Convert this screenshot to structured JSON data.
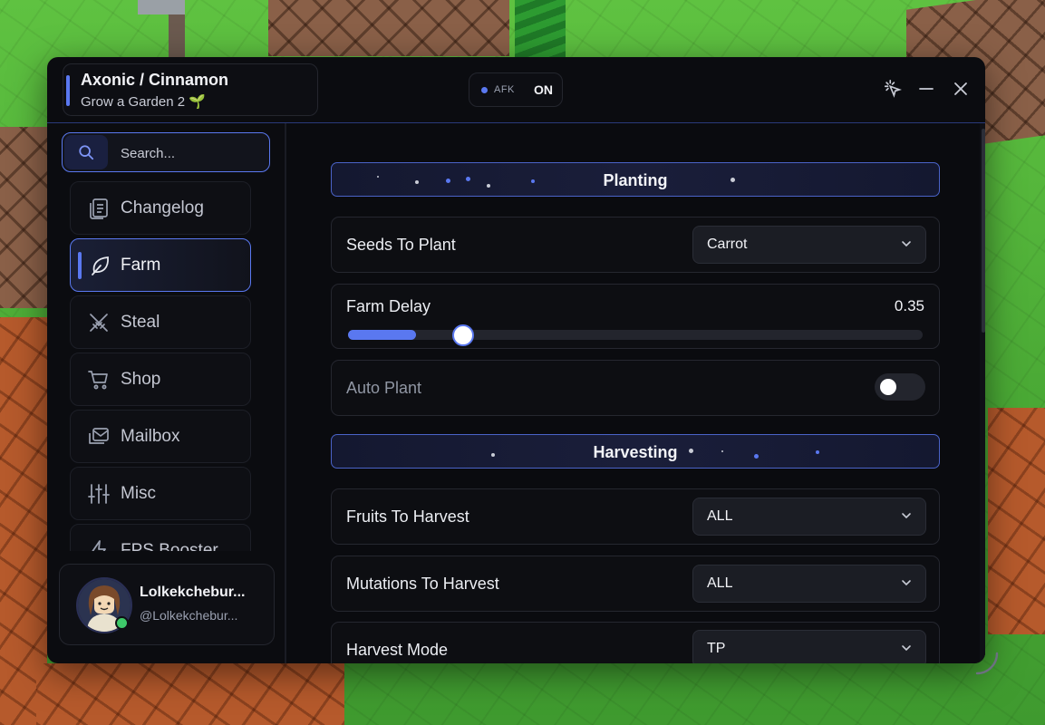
{
  "window": {
    "title": "Axonic / Cinnamon",
    "subtitle": "Grow a Garden 2",
    "subtitle_icon": "🌱",
    "afk": {
      "label": "AFK",
      "state": "ON"
    },
    "controls": [
      "cursor-click-icon",
      "minimize-icon",
      "close-icon"
    ]
  },
  "colors": {
    "accent": "#5a78f0",
    "online": "#3ec96a",
    "window_bg": "#0b0c10"
  },
  "sidebar": {
    "search": {
      "placeholder": "Search..."
    },
    "items": [
      {
        "label": "Changelog",
        "icon": "changelog-icon",
        "active": false
      },
      {
        "label": "Farm",
        "icon": "leaf-icon",
        "active": true
      },
      {
        "label": "Steal",
        "icon": "swords-icon",
        "active": false
      },
      {
        "label": "Shop",
        "icon": "cart-icon",
        "active": false
      },
      {
        "label": "Mailbox",
        "icon": "mailbox-icon",
        "active": false
      },
      {
        "label": "Misc",
        "icon": "sliders-icon",
        "active": false
      },
      {
        "label": "FPS Booster",
        "icon": "lightning-icon",
        "active": false
      }
    ],
    "profile": {
      "name": "Lolkekchebur...",
      "handle": "@Lolkekchebur...",
      "status": "online"
    }
  },
  "main": {
    "sections": [
      {
        "title": "Planting",
        "rows": [
          {
            "type": "dropdown",
            "label": "Seeds To Plant",
            "value": "Carrot"
          },
          {
            "type": "slider",
            "label": "Farm Delay",
            "value": "0.35",
            "fraction": 0.105
          },
          {
            "type": "toggle",
            "label": "Auto Plant",
            "enabled": false
          }
        ]
      },
      {
        "title": "Harvesting",
        "rows": [
          {
            "type": "dropdown",
            "label": "Fruits To Harvest",
            "value": "ALL"
          },
          {
            "type": "dropdown",
            "label": "Mutations To Harvest",
            "value": "ALL"
          },
          {
            "type": "dropdown",
            "label": "Harvest Mode",
            "value": "TP"
          }
        ]
      }
    ]
  }
}
